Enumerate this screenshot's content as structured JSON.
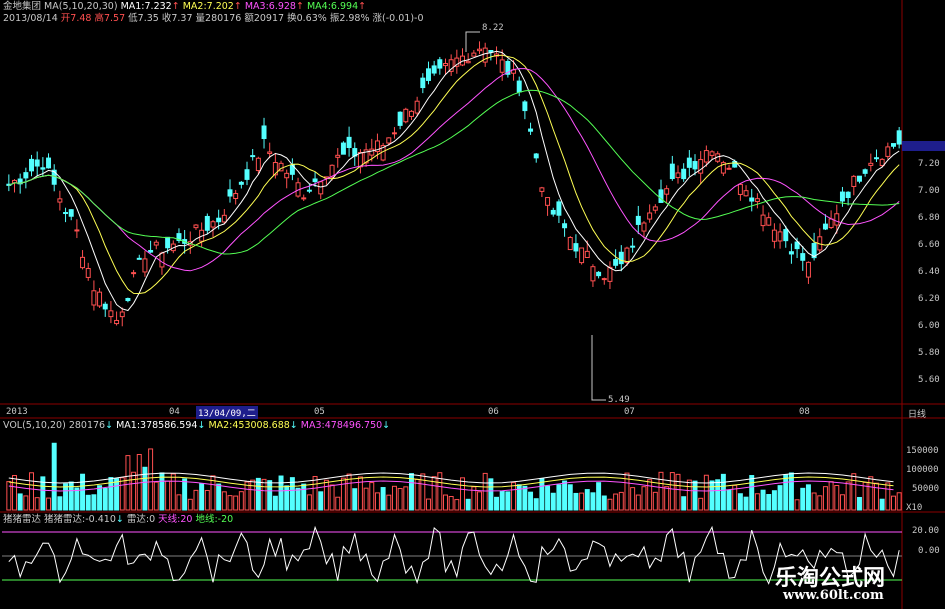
{
  "header": {
    "stock_name": "金地集团",
    "ma_title": "MA(5,10,20,30)",
    "ma1": "MA1:7.232",
    "ma2": "MA2:7.202",
    "ma3": "MA3:6.928",
    "ma4": "MA4:6.994",
    "date": "2013/08/14",
    "open": "开7.48",
    "high": "高7.57",
    "low": "低7.35",
    "close": "收7.37",
    "volume": "量280176",
    "amount": "额20917",
    "turnover": "换0.63%",
    "amplitude": "振2.98%",
    "change": "涨(-0.01)-0"
  },
  "price_axis": {
    "ticks": [
      "7.20",
      "7.00",
      "6.80",
      "6.60",
      "6.40",
      "6.20",
      "6.00",
      "5.80",
      "5.60"
    ],
    "current_price_box": ""
  },
  "annotations": {
    "high_label": "8.22",
    "low_label": "5.49"
  },
  "time_axis": {
    "labels": [
      "2013",
      "04",
      "05",
      "06",
      "07",
      "08"
    ],
    "cursor_date": "13/04/09,二",
    "period": "日线"
  },
  "volume_panel": {
    "title": "VOL(5,10,20)",
    "value": "280176",
    "ma1": "MA1:378586.594",
    "ma2": "MA2:453008.688",
    "ma3": "MA3:478496.750",
    "ticks": [
      "150000",
      "100000",
      "50000"
    ],
    "unit": "X10"
  },
  "indicator_panel": {
    "name": "猪猪雷达",
    "value_label": "猪猪雷达:-0.410",
    "radar": "雷达:0",
    "sky": "天线:20",
    "ground": "地线:-20",
    "ticks": [
      "20.00",
      "0.00"
    ]
  },
  "watermark": {
    "line1": "乐淘公式网",
    "line2": "www.60lt.com"
  },
  "colors": {
    "up": "#ff5050",
    "down": "#54ffff",
    "ma1": "#ffffff",
    "ma2": "#ffff54",
    "ma3": "#ff54ff",
    "ma4": "#54ff54",
    "grid": "#8b0000",
    "indicator_line": "#ffffff",
    "sky_line": "#ff54ff",
    "ground_line": "#54ff54"
  }
}
